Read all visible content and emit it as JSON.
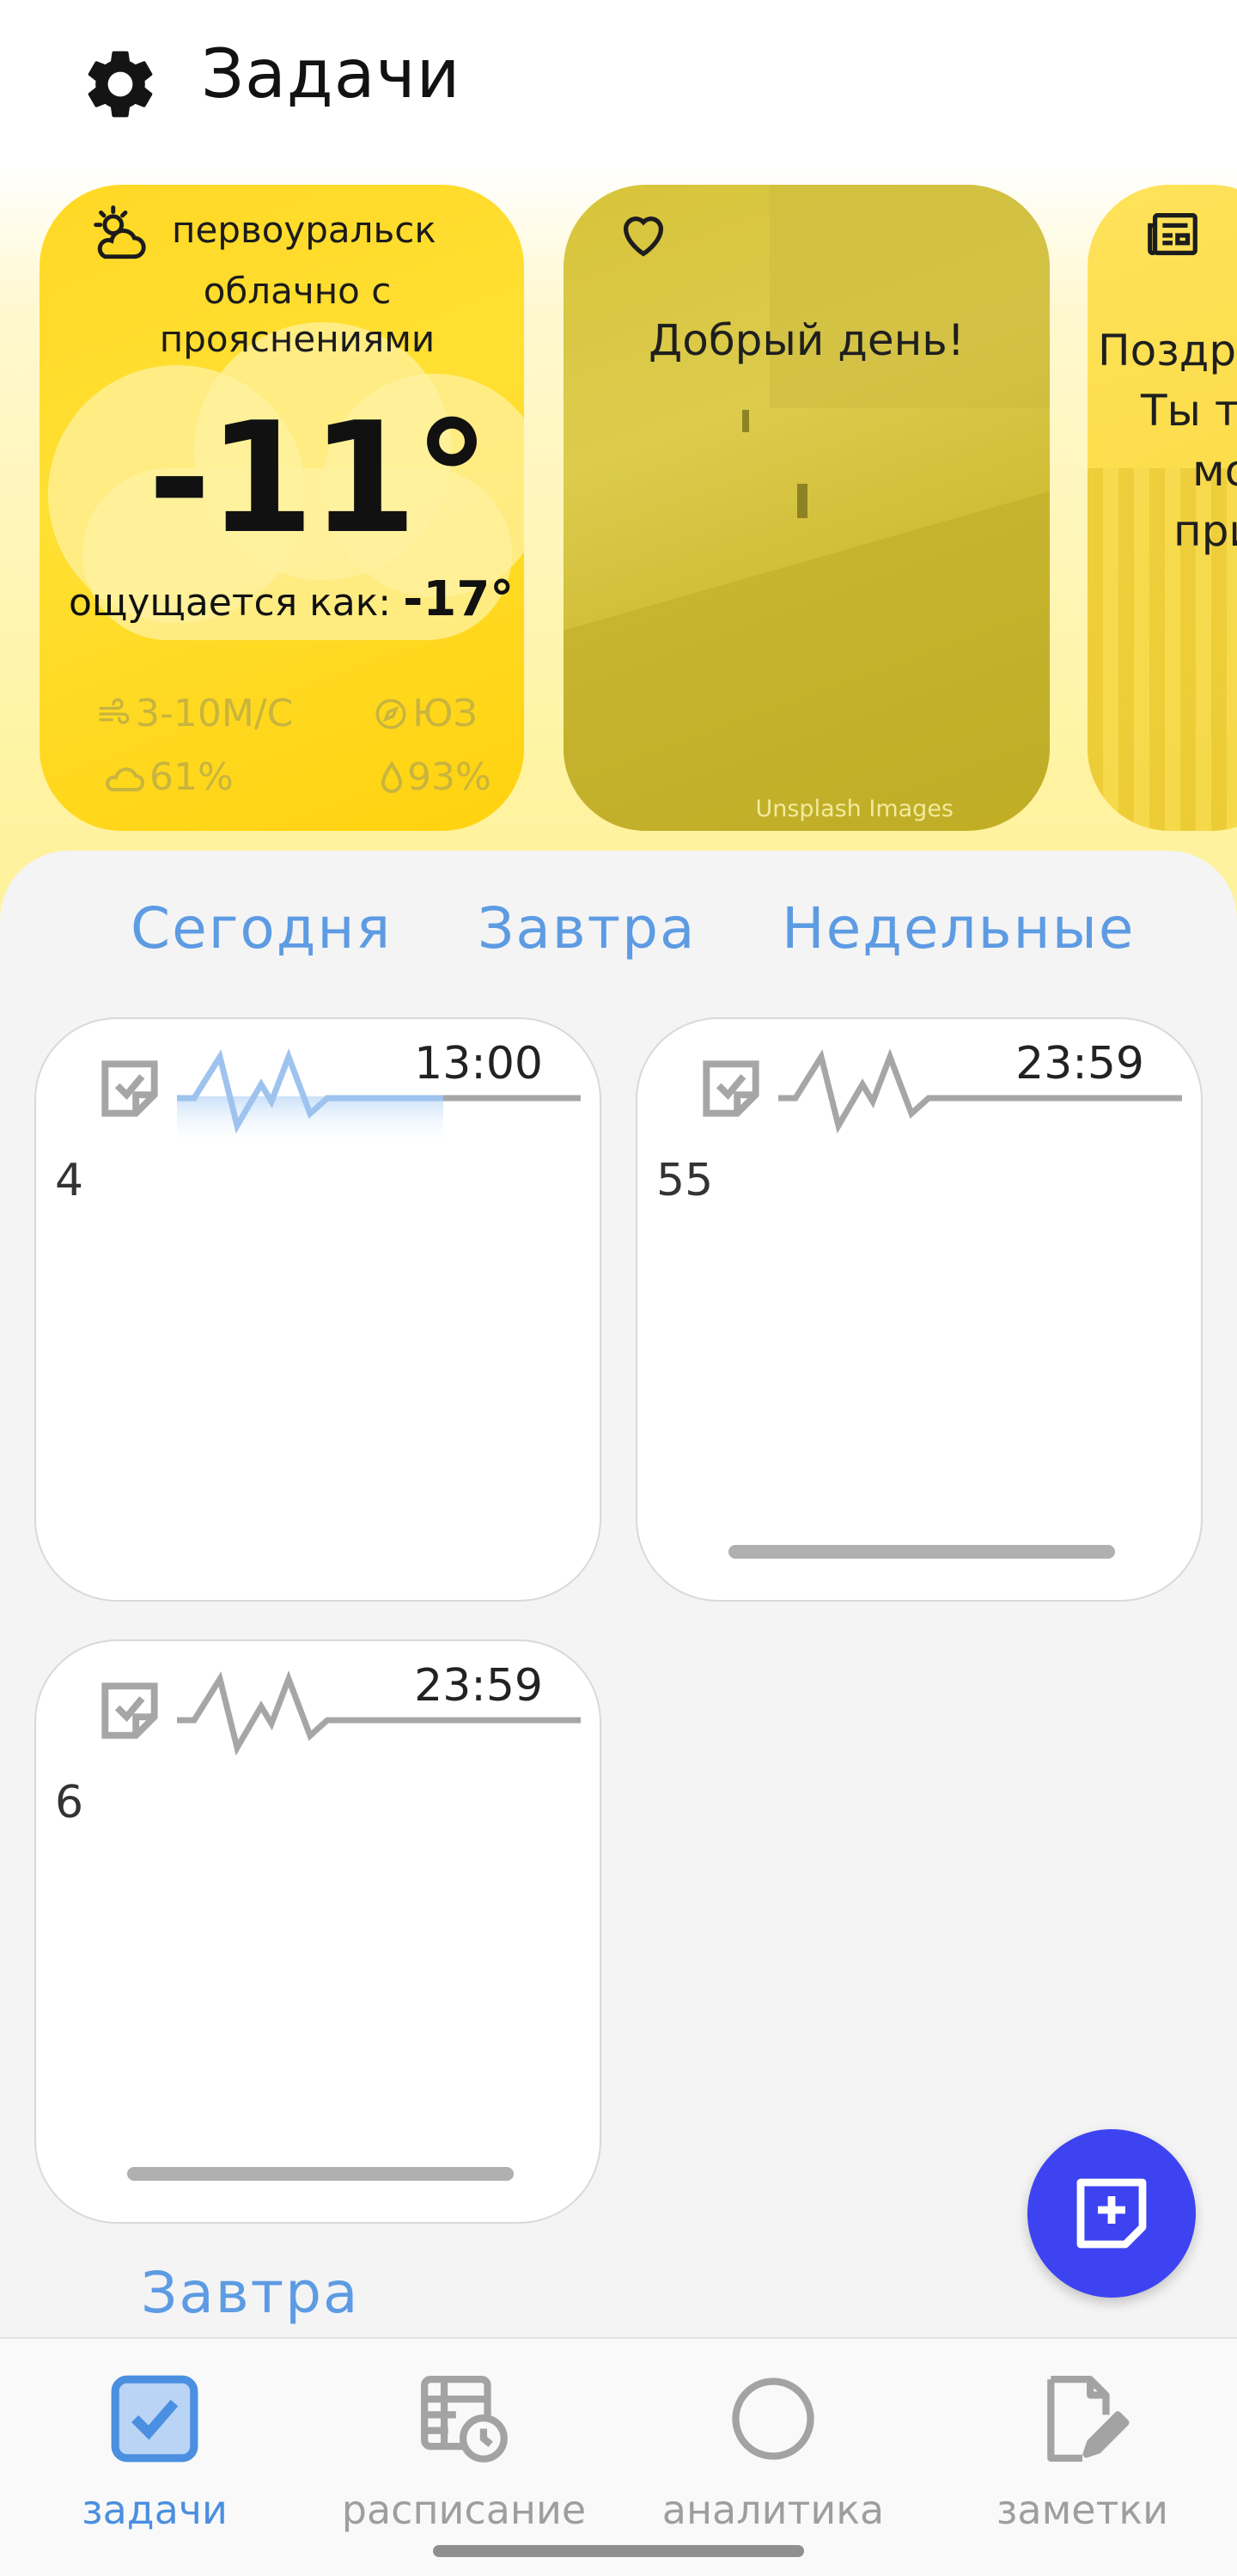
{
  "header": {
    "title": "Задачи",
    "settings_icon": "gear-icon"
  },
  "weather": {
    "city": "первоуральск",
    "condition": "облачно с прояснениями",
    "temperature": "-11°",
    "feels_label": "ощущается как:",
    "feels_value": "-17°",
    "wind": "3-10М/С",
    "direction": "ЮЗ",
    "cloudiness": "61%",
    "humidity": "93%"
  },
  "photo_card": {
    "greeting": "Добрый день!",
    "credit": "Unsplash Images"
  },
  "news_card": {
    "lines": [
      "Поздра",
      "Ты те",
      "мо",
      "при"
    ]
  },
  "tabs": [
    "Сегодня",
    "Завтра",
    "Недельные"
  ],
  "tasks": [
    {
      "time": "13:00",
      "number": "4"
    },
    {
      "time": "23:59",
      "number": "55"
    },
    {
      "time": "23:59",
      "number": "6"
    }
  ],
  "section_next": "Завтра",
  "fab": {
    "icon": "add-note-icon"
  },
  "nav": [
    {
      "label": "задачи",
      "icon": "tasks-icon",
      "active": true
    },
    {
      "label": "расписание",
      "icon": "schedule-icon",
      "active": false
    },
    {
      "label": "аналитика",
      "icon": "analytics-icon",
      "active": false
    },
    {
      "label": "заметки",
      "icon": "notes-icon",
      "active": false
    }
  ],
  "colors": {
    "accent": "#5d9be3",
    "fab": "#3e43f1",
    "weather_card": "#ffd825"
  }
}
